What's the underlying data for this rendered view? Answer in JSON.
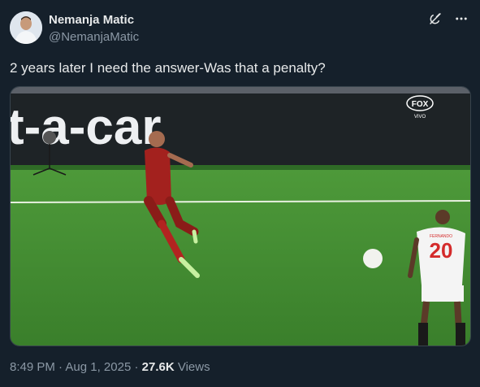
{
  "author": {
    "name": "Nemanja Matic",
    "handle": "@NemanjaMatic"
  },
  "icons": {
    "grok": "grok-icon",
    "more": "more-options-icon"
  },
  "tweet": {
    "text": "2 years later I need the answer-Was that a penalty?"
  },
  "media": {
    "banner_text": "t-a-car",
    "broadcaster_logo": "FOX",
    "broadcaster_subtext": "VIVO",
    "player_shirt_number": "20",
    "player_shirt_name": "FERNANDO"
  },
  "meta": {
    "time": "8:49 PM",
    "separator": "·",
    "date": "Aug 1, 2025",
    "views_count": "27.6K",
    "views_label": "Views"
  },
  "colors": {
    "background": "#15202b",
    "text_primary": "#e7e9ea",
    "text_secondary": "#8b98a5",
    "pitch_green": "#3f8a2e"
  }
}
